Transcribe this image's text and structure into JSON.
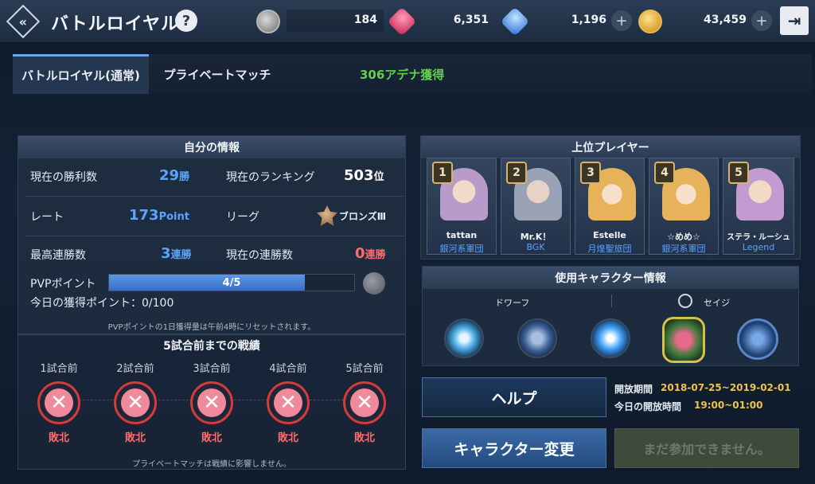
{
  "header": {
    "title": "バトルロイヤル",
    "help": "?",
    "resources": [
      {
        "icon": "emblem-icon",
        "value": "184"
      },
      {
        "icon": "red-gem-icon",
        "value": "6,351"
      },
      {
        "icon": "blue-gem-icon",
        "value": "1,196"
      },
      {
        "icon": "gold-coin-icon",
        "value": "43,459"
      }
    ]
  },
  "tabs": [
    {
      "label": "バトルロイヤル(通常)",
      "active": true
    },
    {
      "label": "プライベートマッチ",
      "active": false
    }
  ],
  "arena_gain": "306アデナ獲得",
  "my_info": {
    "title": "自分の情報",
    "win_count_label": "現在の勝利数",
    "win_count": "29",
    "win_unit": "勝",
    "ranking_label": "現在のランキング",
    "ranking": "503",
    "ranking_unit": "位",
    "rate_label": "レート",
    "rate": "173",
    "rate_unit": "Point",
    "league_label": "リーグ",
    "league": "ブロンズⅢ",
    "best_streak_label": "最高連勝数",
    "best_streak": "3",
    "best_streak_unit": "連勝",
    "cur_streak_label": "現在の連勝数",
    "cur_streak": "0",
    "cur_streak_unit": "連勝",
    "pvp_label": "PVPポイント",
    "pvp_value": "4/5",
    "pvp_fraction": 0.8,
    "today_points": "今日の獲得ポイント：0/100",
    "reset_note": "PVPポイントの1日獲得量は午前4時にリセットされます。"
  },
  "history": {
    "title": "5試合前までの戦績",
    "matches": [
      {
        "label": "1試合前",
        "result": "敗北"
      },
      {
        "label": "2試合前",
        "result": "敗北"
      },
      {
        "label": "3試合前",
        "result": "敗北"
      },
      {
        "label": "4試合前",
        "result": "敗北"
      },
      {
        "label": "5試合前",
        "result": "敗北"
      }
    ],
    "note": "プライベートマッチは戦績に影響しません。"
  },
  "top_players": {
    "title": "上位プレイヤー",
    "players": [
      {
        "rank": "1",
        "name": "tattan",
        "guild": "銀河系軍団",
        "color": "#b89acb"
      },
      {
        "rank": "2",
        "name": "Mr.K！",
        "guild": "BGK",
        "color": "#9aa3b5"
      },
      {
        "rank": "3",
        "name": "Estelle",
        "guild": "月煌聖旅団",
        "color": "#e7b25a"
      },
      {
        "rank": "4",
        "name": "☆めめ☆",
        "guild": "銀河系軍団",
        "color": "#e7b25a"
      },
      {
        "rank": "5",
        "name": "ステラ・ルーシュ",
        "guild": "Legend",
        "color": "#c29bd0"
      }
    ]
  },
  "character_info": {
    "title": "使用キャラクター情報",
    "race": "ドワーフ",
    "class": "セイジ"
  },
  "buttons": {
    "help": "ヘルプ",
    "change_character": "キャラクター変更",
    "not_joinable": "まだ参加できません。"
  },
  "schedule": {
    "period_label": "開放期間",
    "period": "2018-07-25~2019-02-01",
    "time_label": "今日の開放時間",
    "time": "19:00~01:00"
  }
}
